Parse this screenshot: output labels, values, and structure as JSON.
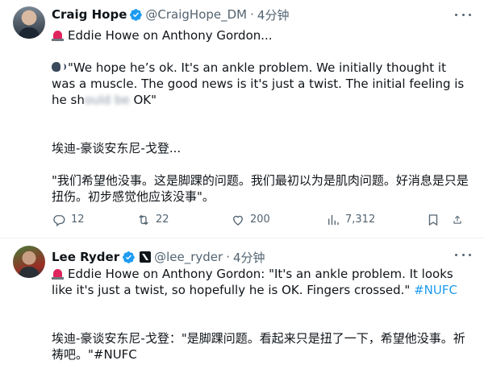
{
  "tweets": [
    {
      "author_name": "Craig Hope",
      "handle": "@CraigHope_DM",
      "separator": "·",
      "time": "4分钟",
      "title_line": "Eddie Howe on Anthony Gordon...",
      "quote_part1": "\"We hope he’s ok. It's an ankle problem. We initially thought it was a muscle. The good news is it's just a twist. The initial feeling is he sh",
      "quote_blurred": "ould be",
      "quote_part2": " OK\"",
      "zh_title": "埃迪-豪谈安东尼-戈登...",
      "zh_quote": "\"我们希望他没事。这是脚踝的问题。我们最初以为是肌肉问题。好消息是只是扭伤。初步感觉他应该没事\"。",
      "stats": {
        "replies": "12",
        "reposts": "22",
        "likes": "200",
        "views": "7,312"
      },
      "icons": [
        "verified-badge-icon",
        "more-icon",
        "siren-icon",
        "speaking-head-icon",
        "reply-icon",
        "repost-icon",
        "like-icon",
        "views-icon",
        "bookmark-icon",
        "share-icon"
      ]
    },
    {
      "author_name": "Lee Ryder",
      "handle": "@lee_ryder",
      "separator": "·",
      "time": "4分钟",
      "text_main": "Eddie Howe on Anthony Gordon: \"It's an ankle problem. It looks like it's just a twist, so hopefully he is OK. Fingers crossed.\" ",
      "hashtag": "#NUFC",
      "zh_text": "埃迪-豪谈安东尼-戈登：\"是脚踝问题。看起来只是扭了一下，希望他没事。祈祷吧。\"#NUFC",
      "icons": [
        "verified-badge-icon",
        "affiliate-badge-icon",
        "siren-icon"
      ]
    }
  ],
  "colors": {
    "text": "#0f1419",
    "secondary": "#536471",
    "accent": "#1d9bf0",
    "divider": "#eff3f4"
  }
}
